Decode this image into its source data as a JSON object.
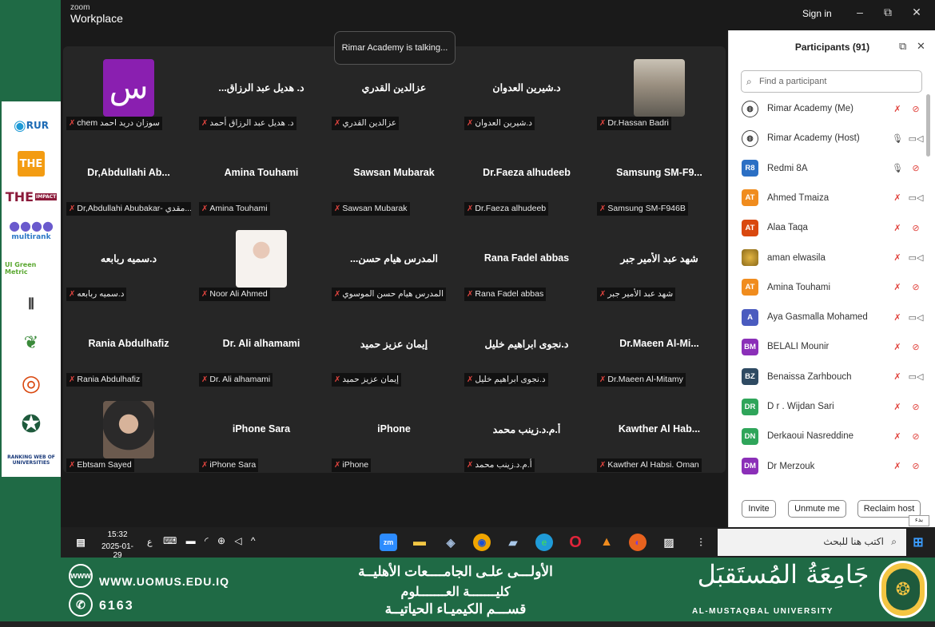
{
  "brand": {
    "line1": "zoom",
    "line2": "Workplace"
  },
  "titlebar": {
    "signin": "Sign in",
    "minimize": "–",
    "restore": "⧉",
    "close": "✕"
  },
  "talking": "Rimar Academy is talking...",
  "tiles": [
    {
      "name": "",
      "label": "chem سوزان درید احمد",
      "photo": "purple-logo",
      "photo_text": "س"
    },
    {
      "name": "...د. هديل عبد الرزاق",
      "label": "د. هديل عبد الرزاق أحمد"
    },
    {
      "name": "عزالدين القدري",
      "label": "عزالدين القدري"
    },
    {
      "name": "د.شيرين العدوان",
      "label": "د.شيرين العدوان"
    },
    {
      "name": "",
      "label": "Dr.Hassan Badri",
      "photo": "street"
    },
    {
      "name": "Dr,Abdullahi Ab...",
      "label": "Dr,Abdullahi Abubakar- مقدي..."
    },
    {
      "name": "Amina Touhami",
      "label": "Amina Touhami"
    },
    {
      "name": "Sawsan Mubarak",
      "label": "Sawsan Mubarak"
    },
    {
      "name": "Dr.Faeza alhudeeb",
      "label": "Dr.Faeza alhudeeb"
    },
    {
      "name": "Samsung SM-F9...",
      "label": "Samsung SM-F946B"
    },
    {
      "name": "د.سميه ربابعه",
      "label": "د.سميه ربابعه"
    },
    {
      "name": "",
      "label": "Noor Ali Ahmed",
      "photo": "bride"
    },
    {
      "name": "...المدرس هيام حسن",
      "label": "المدرس هيام حسن الموسوي"
    },
    {
      "name": "Rana Fadel abbas",
      "label": "Rana Fadel abbas"
    },
    {
      "name": "شهد عبد الأمير جبر",
      "label": "شهد عبد الأمير جبر"
    },
    {
      "name": "Rania Abdulhafiz",
      "label": "Rania Abdulhafiz"
    },
    {
      "name": "Dr. Ali alhamami",
      "label": "Dr. Ali alhamami"
    },
    {
      "name": "إيمان عزيز حميد",
      "label": "إيمان عزيز حميد"
    },
    {
      "name": "د.نجوى ابراهيم خليل",
      "label": "د.نجوى ابراهيم خليل"
    },
    {
      "name": "Dr.Maeen  Al-Mi...",
      "label": "Dr.Maeen Al-Mitamy"
    },
    {
      "name": "",
      "label": "Ebtsam Sayed",
      "photo": "woman"
    },
    {
      "name": "iPhone Sara",
      "label": "iPhone Sara"
    },
    {
      "name": "iPhone",
      "label": "iPhone"
    },
    {
      "name": "أ.م.د.زينب محمد",
      "label": "أ.م.د.زينب محمد"
    },
    {
      "name": "Kawther Al Hab...",
      "label": "Kawther Al Habsi. Oman"
    }
  ],
  "participants": {
    "title": "Participants (91)",
    "search_placeholder": "Find a participant",
    "list": [
      {
        "initials": "",
        "name": "Rimar Academy (Me)",
        "color": "#444",
        "logo": true,
        "mic": "off",
        "cam": "off"
      },
      {
        "initials": "",
        "name": "Rimar Academy (Host)",
        "color": "#444",
        "logo": true,
        "mic": "on",
        "cam": "on"
      },
      {
        "initials": "R8",
        "name": "Redmi 8A",
        "color": "#2b6fc4",
        "mic": "on",
        "cam": "off"
      },
      {
        "initials": "AT",
        "name": "Ahmed Tmaiza",
        "color": "#f08c1e",
        "mic": "off",
        "cam": "on"
      },
      {
        "initials": "AT",
        "name": "Alaa Taqa",
        "color": "#d9480f",
        "mic": "off",
        "cam": "off"
      },
      {
        "initials": "",
        "name": "aman elwasila",
        "color": "#c9a23a",
        "photo": true,
        "mic": "off",
        "cam": "on"
      },
      {
        "initials": "AT",
        "name": "Amina Touhami",
        "color": "#f08c1e",
        "mic": "off",
        "cam": "off"
      },
      {
        "initials": "A",
        "name": "Aya Gasmalla Mohamed",
        "color": "#4a5bbf",
        "mic": "off",
        "cam": "on"
      },
      {
        "initials": "BM",
        "name": "BELALI Mounir",
        "color": "#8b2fb8",
        "mic": "off",
        "cam": "off"
      },
      {
        "initials": "BZ",
        "name": "Benaissa Zarhbouch",
        "color": "#2e4a62",
        "mic": "off",
        "cam": "on"
      },
      {
        "initials": "DR",
        "name": "D r . Wijdan Sari",
        "color": "#2fa55a",
        "mic": "off",
        "cam": "off"
      },
      {
        "initials": "DN",
        "name": "Derkaoui Nasreddine",
        "color": "#2fa55a",
        "mic": "off",
        "cam": "off"
      },
      {
        "initials": "DM",
        "name": "Dr Merzouk",
        "color": "#8b2fb8",
        "mic": "off",
        "cam": "off"
      }
    ],
    "buttons": {
      "invite": "Invite",
      "unmute": "Unmute me",
      "reclaim": "Reclaim host"
    },
    "tooltip": "بدء"
  },
  "taskbar": {
    "time": "15:32",
    "date": "2025-01-29",
    "lang": "ع",
    "search": "اكتب هنا للبحث",
    "zoom_icon": "zm"
  },
  "footer": {
    "website": "WWW.UOMUS.EDU.IQ",
    "phone": "6163",
    "line1": "الأولـــى علـى الجامــــعات الأهليــة",
    "line2": "كليـــــــة العـــــــلوم",
    "line3": "قســـم الكيميـاء الحياتيــة",
    "uni_ar": "جَامِعَةُ المُستَقبَل",
    "uni_en": "AL-MUSTAQBAL UNIVERSITY"
  },
  "logos": {
    "rur": "RUR",
    "the": "THE",
    "the_impact": "THE",
    "multirank": "multirank",
    "ui": "UI Green Metric",
    "ranking_web": "RANKING WEB OF UNIVERSITIES"
  }
}
